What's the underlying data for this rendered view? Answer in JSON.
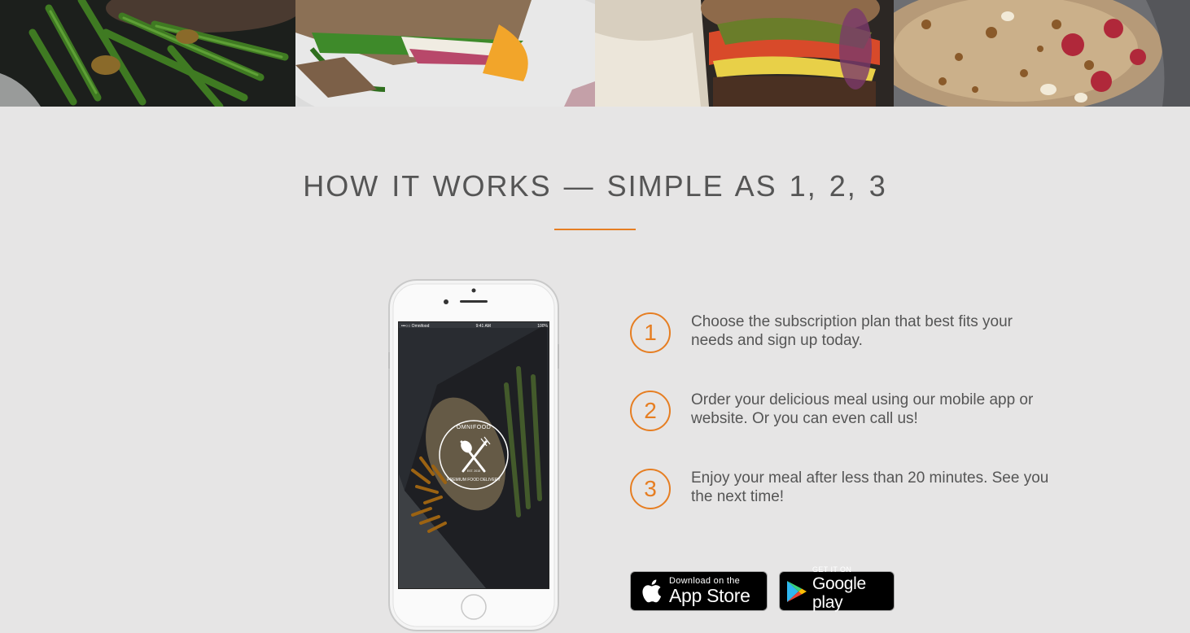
{
  "photo_strip": {
    "photos": [
      {
        "name": "steak-green-beans-photo"
      },
      {
        "name": "sandwich-photo"
      },
      {
        "name": "burger-photo"
      },
      {
        "name": "granola-photo"
      }
    ]
  },
  "section": {
    "title": "HOW IT WORKS — SIMPLE AS 1, 2, 3",
    "accent_color": "#e67e22",
    "background_color": "#e6e5e5"
  },
  "phone": {
    "status_carrier": "•••○○ Omnifood",
    "status_time": "9:41 AM",
    "status_battery": "100%",
    "logo_top": "OMNIFOOD",
    "logo_bottom": "PREMIUM FOOD DELIVERY",
    "logo_est": "EST. 2015"
  },
  "steps": [
    {
      "number": "1",
      "text": "Choose the subscription plan that best fits your needs and sign up today."
    },
    {
      "number": "2",
      "text": "Order your delicious meal using our mobile app or website. Or you can even call us!"
    },
    {
      "number": "3",
      "text": "Enjoy your meal after less than 20 minutes. See you the next time!"
    }
  ],
  "badges": {
    "app_store": {
      "small": "Download on the",
      "big": "App Store"
    },
    "google_play": {
      "small": "GET IT ON",
      "big": "Google play"
    }
  }
}
